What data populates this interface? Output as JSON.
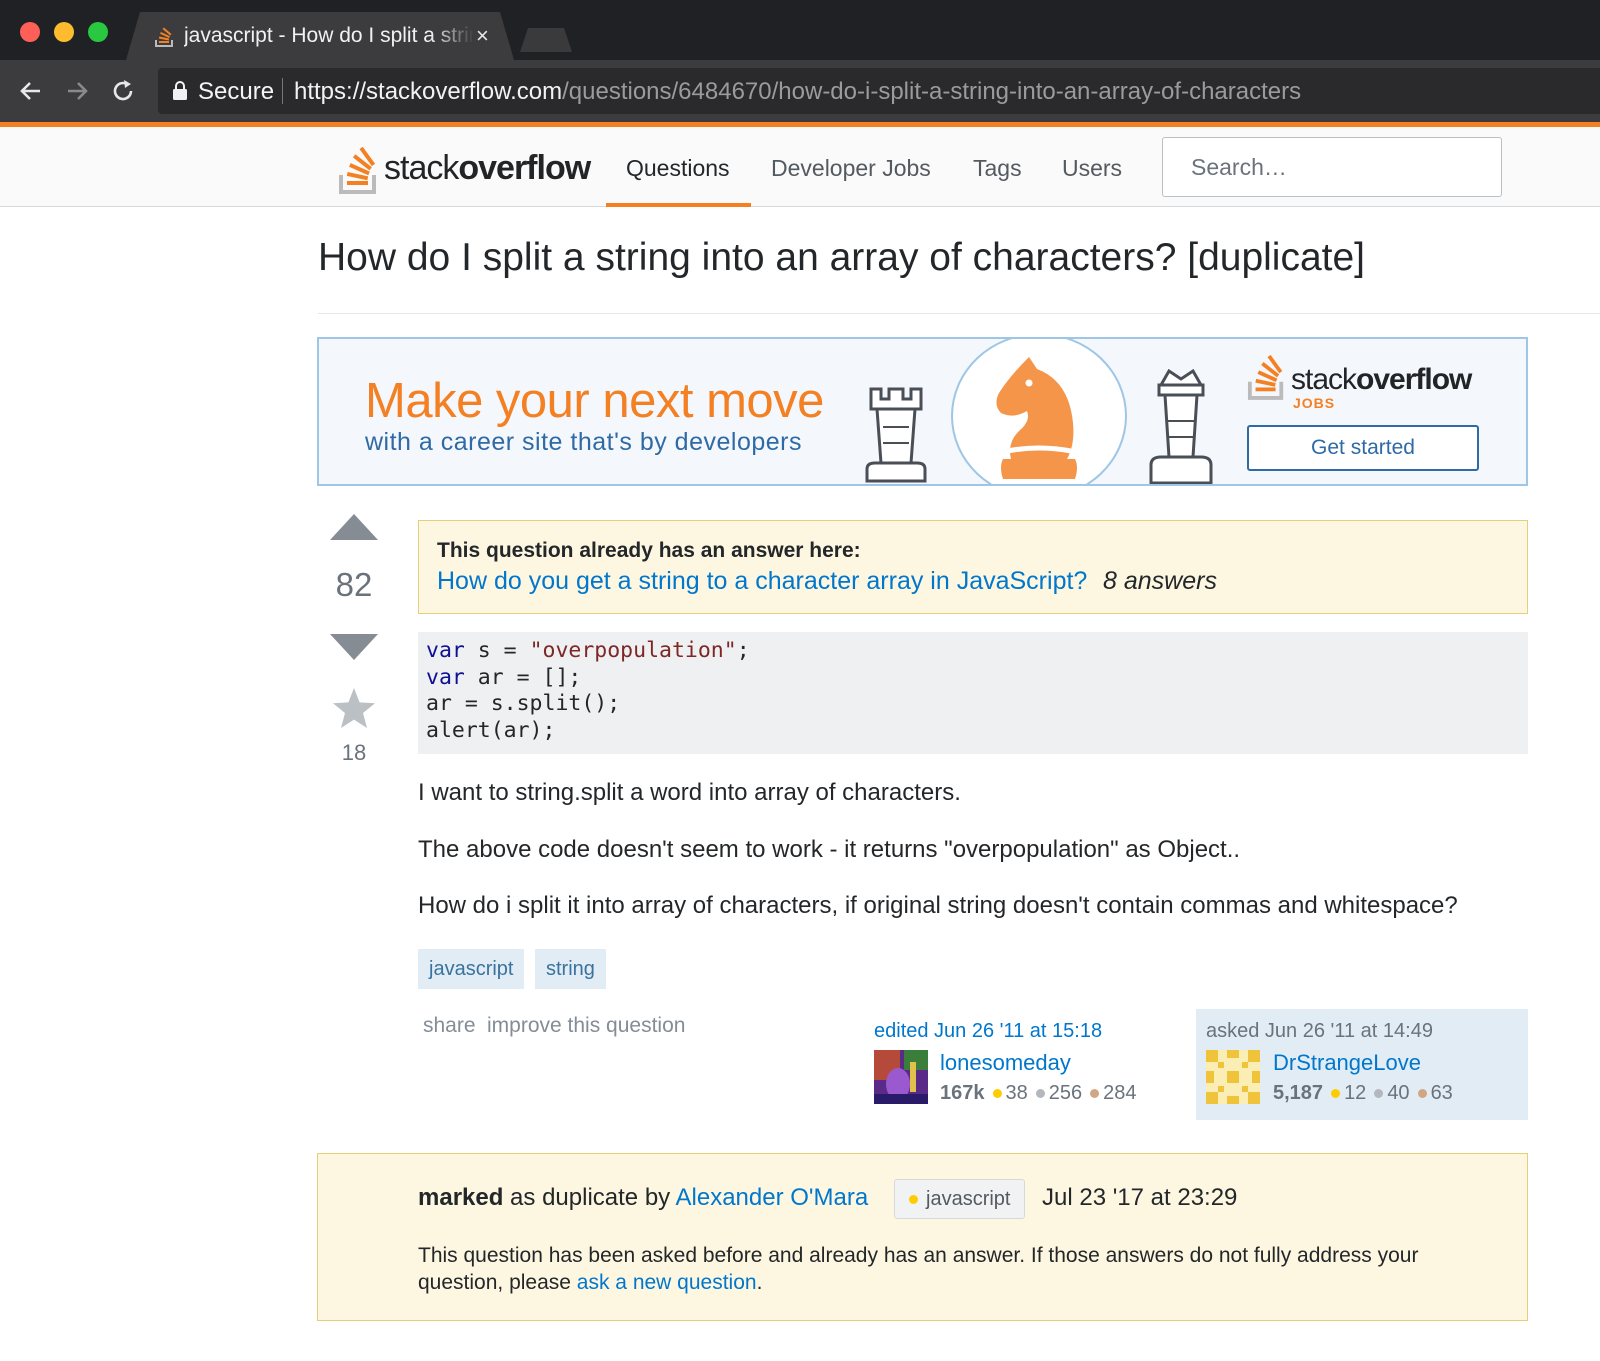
{
  "browser": {
    "tab_title": "javascript - How do I split a string into an array of characters?",
    "tab_close": "×",
    "secure_label": "Secure",
    "url_host": "https://stackoverflow.com",
    "url_path": "/questions/6484670/how-do-i-split-a-string-into-an-array-of-characters"
  },
  "header": {
    "logo_light": "stack",
    "logo_bold": "overflow",
    "nav": [
      "Questions",
      "Developer Jobs",
      "Tags",
      "Users"
    ],
    "active_nav": "Questions",
    "search_placeholder": "Search…"
  },
  "question": {
    "title": "How do I split a string into an array of characters? [duplicate]",
    "votes": "82",
    "favorites": "18",
    "duplicate_notice": {
      "heading": "This question already has an answer here:",
      "link": "How do you get a string to a character array in JavaScript?",
      "answers": "8 answers"
    },
    "code": {
      "line1_kw": "var",
      "line1_rest": " s = ",
      "line1_str": "\"overpopulation\"",
      "line1_end": ";",
      "line2_kw": "var",
      "line2_rest": " ar = [];",
      "line3": "ar = s.split();",
      "line4": "alert(ar);"
    },
    "paragraphs": [
      "I want to string.split a word into array of characters.",
      "The above code doesn't seem to work - it returns \"overpopulation\" as Object..",
      "How do i split it into array of characters, if original string doesn't contain commas and whitespace?"
    ],
    "tags": [
      "javascript",
      "string"
    ],
    "menu": [
      "share",
      "improve this question"
    ],
    "editor": {
      "label": "edited Jun 26 '11 at 15:18",
      "name": "lonesomeday",
      "rep": "167k",
      "gold": "38",
      "silver": "256",
      "bronze": "284"
    },
    "owner": {
      "label": "asked Jun 26 '11 at 14:49",
      "name": "DrStrangeLove",
      "rep": "5,187",
      "gold": "12",
      "silver": "40",
      "bronze": "63"
    }
  },
  "ad": {
    "headline": "Make your next move",
    "subline": "with a career site that's by developers",
    "logo_light": "stack",
    "logo_bold": "overflow",
    "jobs": "JOBS",
    "button": "Get started"
  },
  "closed_notice": {
    "marked": "marked",
    "as_duplicate_by": " as duplicate by ",
    "moderator": "Alexander O'Mara",
    "tag": "javascript",
    "date": "Jul 23 '17 at 23:29",
    "text_before": "This question has been asked before and already has an answer. If those answers do not fully address your question, please ",
    "link": "ask a new question",
    "text_after": "."
  },
  "colors": {
    "accent": "#f48024",
    "link": "#0077cc",
    "notice_bg": "#fdf7e2",
    "tag_bg": "#e1ecf4"
  }
}
